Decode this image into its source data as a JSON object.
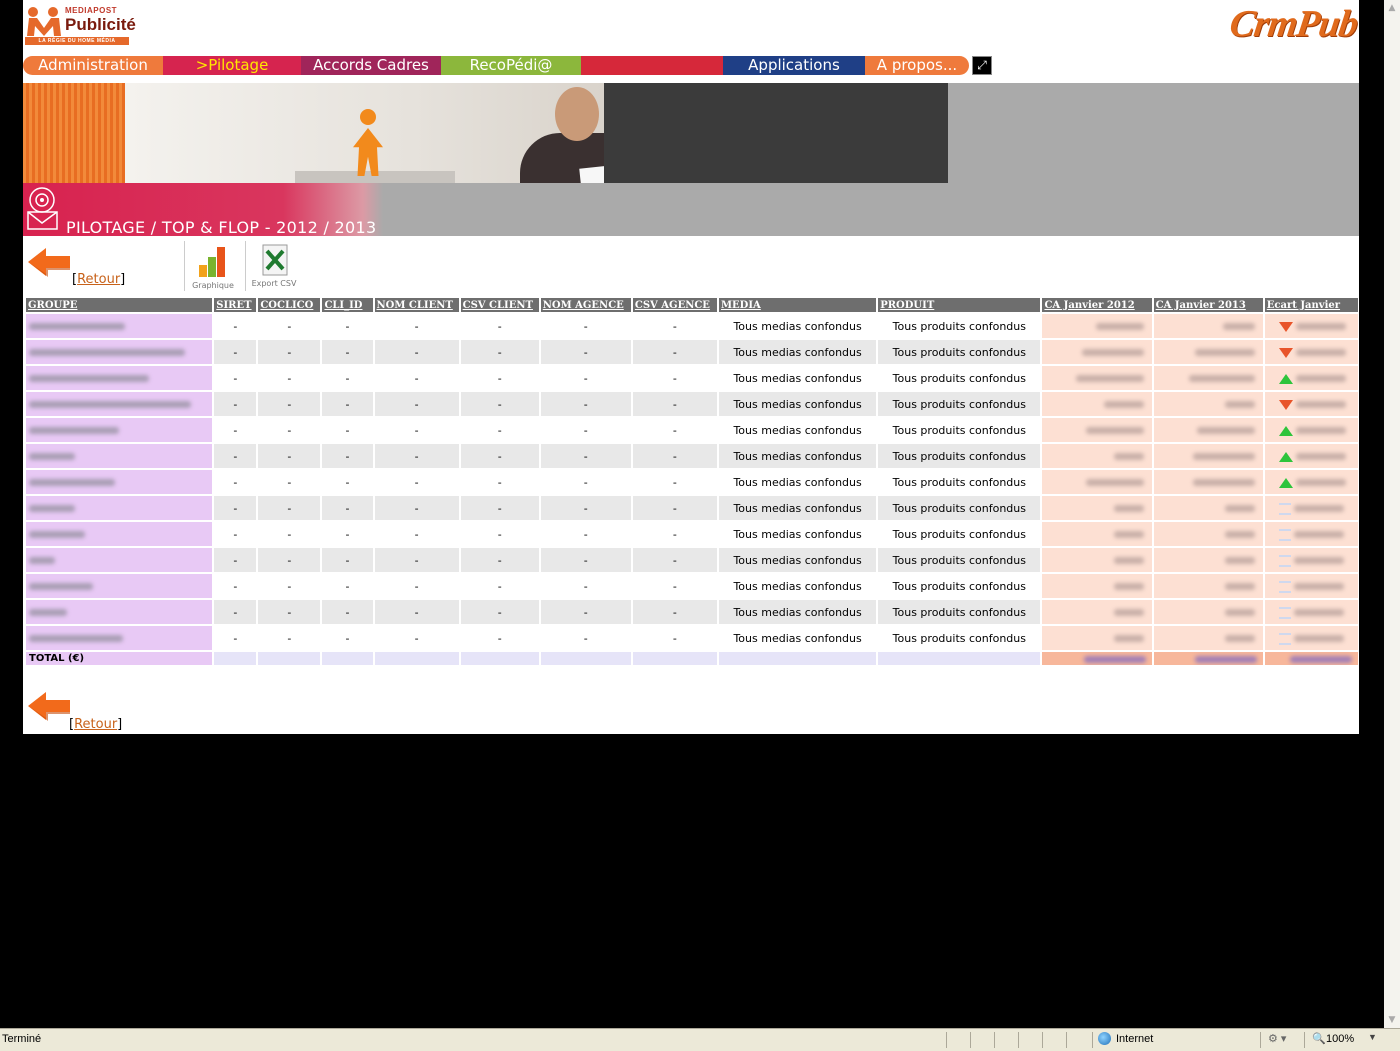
{
  "header": {
    "logo_brand_top": "MEDIAPOST",
    "logo_brand_main": "Publicité",
    "logo_tagline": "LA RÉGIE DU HOME MÉDIA",
    "app_logo": "CrmPub"
  },
  "nav": {
    "tabs": [
      {
        "label": "Administration",
        "color": "#ef7a3c"
      },
      {
        "label": ">Pilotage",
        "color": "#d6244f",
        "text_color": "#ffe800"
      },
      {
        "label": "Accords Cadres",
        "color": "#a0255a"
      },
      {
        "label": "RecoPédi@",
        "color": "#8cb73c"
      },
      {
        "label": "",
        "color": "#d6283a"
      },
      {
        "label": "Applications",
        "color": "#1f3f86"
      },
      {
        "label": "A propos...",
        "color": "#ef7a3c"
      }
    ],
    "fullscreen_icon": "fullscreen-icon"
  },
  "page": {
    "title": "PILOTAGE / TOP & FLOP - 2012 / 2013",
    "back_label": "Retour",
    "tool_chart": "Graphique",
    "tool_export": "Export CSV"
  },
  "table": {
    "headers": [
      "GROUPE",
      "SIRET",
      "COCLICO",
      "CLI_ID",
      "NOM CLIENT",
      "CSV CLIENT",
      "NOM AGENCE",
      "CSV AGENCE",
      "MEDIA",
      "PRODUIT",
      "CA Janvier 2012",
      "CA Janvier 2013",
      "Ecart Janvier"
    ],
    "rows": [
      {
        "siret": "-",
        "coclico": "-",
        "cli_id": "-",
        "nom_client": "-",
        "csv_client": "-",
        "nom_agence": "-",
        "csv_agence": "-",
        "media": "Tous medias confondus",
        "produit": "Tous produits confondus",
        "trend": "down"
      },
      {
        "siret": "-",
        "coclico": "-",
        "cli_id": "-",
        "nom_client": "-",
        "csv_client": "-",
        "nom_agence": "-",
        "csv_agence": "-",
        "media": "Tous medias confondus",
        "produit": "Tous produits confondus",
        "trend": "down"
      },
      {
        "siret": "-",
        "coclico": "-",
        "cli_id": "-",
        "nom_client": "-",
        "csv_client": "-",
        "nom_agence": "-",
        "csv_agence": "-",
        "media": "Tous medias confondus",
        "produit": "Tous produits confondus",
        "trend": "up"
      },
      {
        "siret": "-",
        "coclico": "-",
        "cli_id": "-",
        "nom_client": "-",
        "csv_client": "-",
        "nom_agence": "-",
        "csv_agence": "-",
        "media": "Tous medias confondus",
        "produit": "Tous produits confondus",
        "trend": "down"
      },
      {
        "siret": "-",
        "coclico": "-",
        "cli_id": "-",
        "nom_client": "-",
        "csv_client": "-",
        "nom_agence": "-",
        "csv_agence": "-",
        "media": "Tous medias confondus",
        "produit": "Tous produits confondus",
        "trend": "up"
      },
      {
        "siret": "-",
        "coclico": "-",
        "cli_id": "-",
        "nom_client": "-",
        "csv_client": "-",
        "nom_agence": "-",
        "csv_agence": "-",
        "media": "Tous medias confondus",
        "produit": "Tous produits confondus",
        "trend": "up"
      },
      {
        "siret": "-",
        "coclico": "-",
        "cli_id": "-",
        "nom_client": "-",
        "csv_client": "-",
        "nom_agence": "-",
        "csv_agence": "-",
        "media": "Tous medias confondus",
        "produit": "Tous produits confondus",
        "trend": "up"
      },
      {
        "siret": "-",
        "coclico": "-",
        "cli_id": "-",
        "nom_client": "-",
        "csv_client": "-",
        "nom_agence": "-",
        "csv_agence": "-",
        "media": "Tous medias confondus",
        "produit": "Tous produits confondus",
        "trend": "equal"
      },
      {
        "siret": "-",
        "coclico": "-",
        "cli_id": "-",
        "nom_client": "-",
        "csv_client": "-",
        "nom_agence": "-",
        "csv_agence": "-",
        "media": "Tous medias confondus",
        "produit": "Tous produits confondus",
        "trend": "equal"
      },
      {
        "siret": "-",
        "coclico": "-",
        "cli_id": "-",
        "nom_client": "-",
        "csv_client": "-",
        "nom_agence": "-",
        "csv_agence": "-",
        "media": "Tous medias confondus",
        "produit": "Tous produits confondus",
        "trend": "equal"
      },
      {
        "siret": "-",
        "coclico": "-",
        "cli_id": "-",
        "nom_client": "-",
        "csv_client": "-",
        "nom_agence": "-",
        "csv_agence": "-",
        "media": "Tous medias confondus",
        "produit": "Tous produits confondus",
        "trend": "equal"
      },
      {
        "siret": "-",
        "coclico": "-",
        "cli_id": "-",
        "nom_client": "-",
        "csv_client": "-",
        "nom_agence": "-",
        "csv_agence": "-",
        "media": "Tous medias confondus",
        "produit": "Tous produits confondus",
        "trend": "equal"
      },
      {
        "siret": "-",
        "coclico": "-",
        "cli_id": "-",
        "nom_client": "-",
        "csv_client": "-",
        "nom_agence": "-",
        "csv_agence": "-",
        "media": "Tous medias confondus",
        "produit": "Tous produits confondus",
        "trend": "equal"
      }
    ],
    "total_label": "TOTAL (€)"
  },
  "statusbar": {
    "status": "Terminé",
    "zone": "Internet",
    "zoom": "100%"
  }
}
